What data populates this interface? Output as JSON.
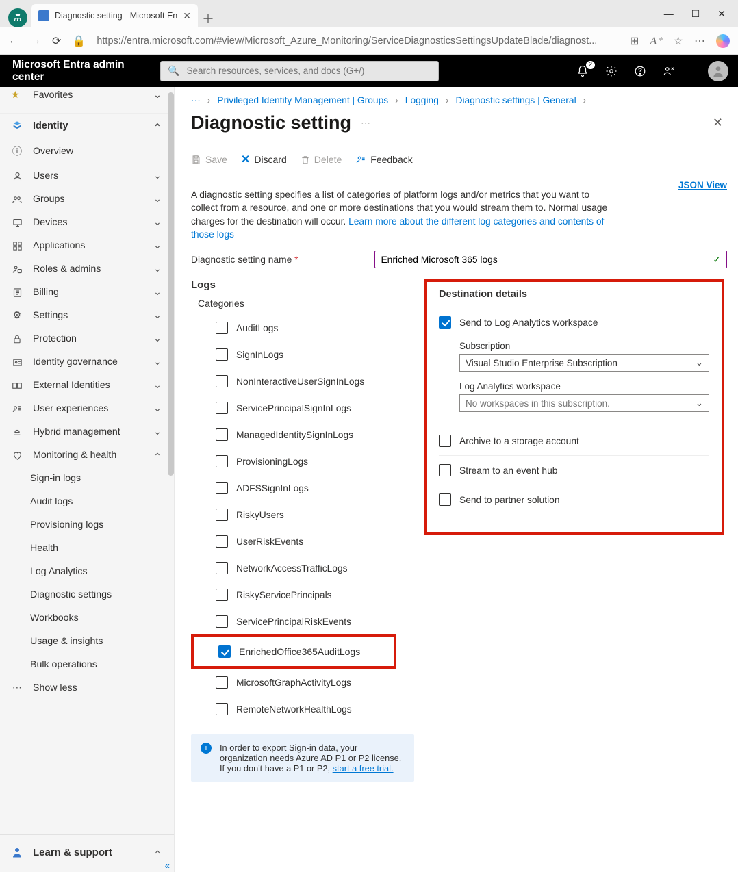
{
  "browser": {
    "tab_title": "Diagnostic setting - Microsoft En",
    "url": "https://entra.microsoft.com/#view/Microsoft_Azure_Monitoring/ServiceDiagnosticsSettingsUpdateBlade/diagnost..."
  },
  "header": {
    "brand": "Microsoft Entra admin center",
    "search_placeholder": "Search resources, services, and docs (G+/)",
    "notification_badge": "2"
  },
  "sidebar": {
    "favorites_stub": "Favorites",
    "identity_header": "Identity",
    "items": [
      {
        "label": "Overview"
      },
      {
        "label": "Users"
      },
      {
        "label": "Groups"
      },
      {
        "label": "Devices"
      },
      {
        "label": "Applications"
      },
      {
        "label": "Roles & admins"
      },
      {
        "label": "Billing"
      },
      {
        "label": "Settings"
      },
      {
        "label": "Protection"
      },
      {
        "label": "Identity governance"
      },
      {
        "label": "External Identities"
      },
      {
        "label": "User experiences"
      },
      {
        "label": "Hybrid management"
      },
      {
        "label": "Monitoring & health"
      }
    ],
    "monitoring_children": [
      {
        "label": "Sign-in logs"
      },
      {
        "label": "Audit logs"
      },
      {
        "label": "Provisioning logs"
      },
      {
        "label": "Health"
      },
      {
        "label": "Log Analytics"
      },
      {
        "label": "Diagnostic settings"
      },
      {
        "label": "Workbooks"
      },
      {
        "label": "Usage & insights"
      },
      {
        "label": "Bulk operations"
      }
    ],
    "show_less": "Show less",
    "footer": "Learn & support"
  },
  "breadcrumbs": {
    "b1": "Privileged Identity Management | Groups",
    "b2": "Logging",
    "b3": "Diagnostic settings | General"
  },
  "page": {
    "title": "Diagnostic setting",
    "toolbar": {
      "save": "Save",
      "discard": "Discard",
      "delete": "Delete",
      "feedback": "Feedback"
    },
    "desc1": "A diagnostic setting specifies a list of categories of platform logs and/or metrics that you want to collect from a resource, and one or more destinations that you would stream them to. Normal usage charges for the destination will occur. ",
    "desc_link": "Learn more about the different log categories and contents of those logs",
    "json_view": "JSON View",
    "name_label": "Diagnostic setting name",
    "name_value": "Enriched Microsoft 365 logs",
    "logs_header": "Logs",
    "categories_header": "Categories",
    "categories": [
      {
        "id": "AuditLogs",
        "checked": false
      },
      {
        "id": "SignInLogs",
        "checked": false
      },
      {
        "id": "NonInteractiveUserSignInLogs",
        "checked": false
      },
      {
        "id": "ServicePrincipalSignInLogs",
        "checked": false
      },
      {
        "id": "ManagedIdentitySignInLogs",
        "checked": false
      },
      {
        "id": "ProvisioningLogs",
        "checked": false
      },
      {
        "id": "ADFSSignInLogs",
        "checked": false
      },
      {
        "id": "RiskyUsers",
        "checked": false
      },
      {
        "id": "UserRiskEvents",
        "checked": false
      },
      {
        "id": "NetworkAccessTrafficLogs",
        "checked": false
      },
      {
        "id": "RiskyServicePrincipals",
        "checked": false
      },
      {
        "id": "ServicePrincipalRiskEvents",
        "checked": false
      },
      {
        "id": "EnrichedOffice365AuditLogs",
        "checked": true,
        "highlight": true
      },
      {
        "id": "MicrosoftGraphActivityLogs",
        "checked": false
      },
      {
        "id": "RemoteNetworkHealthLogs",
        "checked": false
      }
    ],
    "dest_header": "Destination details",
    "destinations": {
      "log_analytics": {
        "label": "Send to Log Analytics workspace",
        "checked": true
      },
      "subscription_label": "Subscription",
      "subscription_value": "Visual Studio Enterprise Subscription",
      "workspace_label": "Log Analytics workspace",
      "workspace_value": "No workspaces in this subscription.",
      "archive": {
        "label": "Archive to a storage account",
        "checked": false
      },
      "eventhub": {
        "label": "Stream to an event hub",
        "checked": false
      },
      "partner": {
        "label": "Send to partner solution",
        "checked": false
      }
    },
    "info_text": "In order to export Sign-in data, your organization needs Azure AD P1 or P2 license. If you don't have a P1 or P2, ",
    "info_link": "start a free trial."
  }
}
